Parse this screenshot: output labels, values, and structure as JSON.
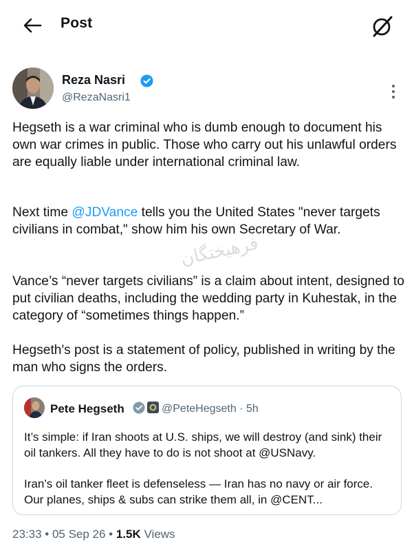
{
  "header": {
    "title": "Post"
  },
  "post": {
    "author": {
      "name": "Reza Nasri",
      "handle": "@RezaNasri1"
    },
    "paragraphs": {
      "p1": "Hegseth is a war criminal who is dumb enough to document his own war crimes in public. Those who carry out his unlawful orders are equally liable under international criminal law.",
      "p2_before": "Next time ",
      "p2_mention": "@JDVance",
      "p2_after": " tells you the United States \"never targets civilians in combat,\" show him his own Secretary of War.",
      "p3": "Vance’s “never targets civilians” is a claim about intent, designed to put civilian deaths, including the wedding party in Kuhestak, in the category of “sometimes things happen.”",
      "p4": "Hegseth's post is a statement of policy, published in writing by the man who signs the orders."
    },
    "watermark": "فرهیختگان"
  },
  "quote": {
    "name": "Pete Hegseth",
    "handle_time": "@PeteHegseth · 5h",
    "para1": "It’s simple: if Iran shoots at U.S. ships, we will destroy (and sink) their oil tankers. All they have to do is not shoot at @USNavy.",
    "para2": "Iran’s oil tanker fleet is defenseless — Iran has no navy or air force. Our planes, ships & subs can strike them all, in @CENT..."
  },
  "meta": {
    "time_date": "23:33 • 05 Sep 26 • ",
    "views_count": "1.5K",
    "views_label": " Views"
  },
  "colors": {
    "accent": "#1d9bf0",
    "text": "#0f1419",
    "muted": "#536471",
    "border": "#cfd9de"
  }
}
